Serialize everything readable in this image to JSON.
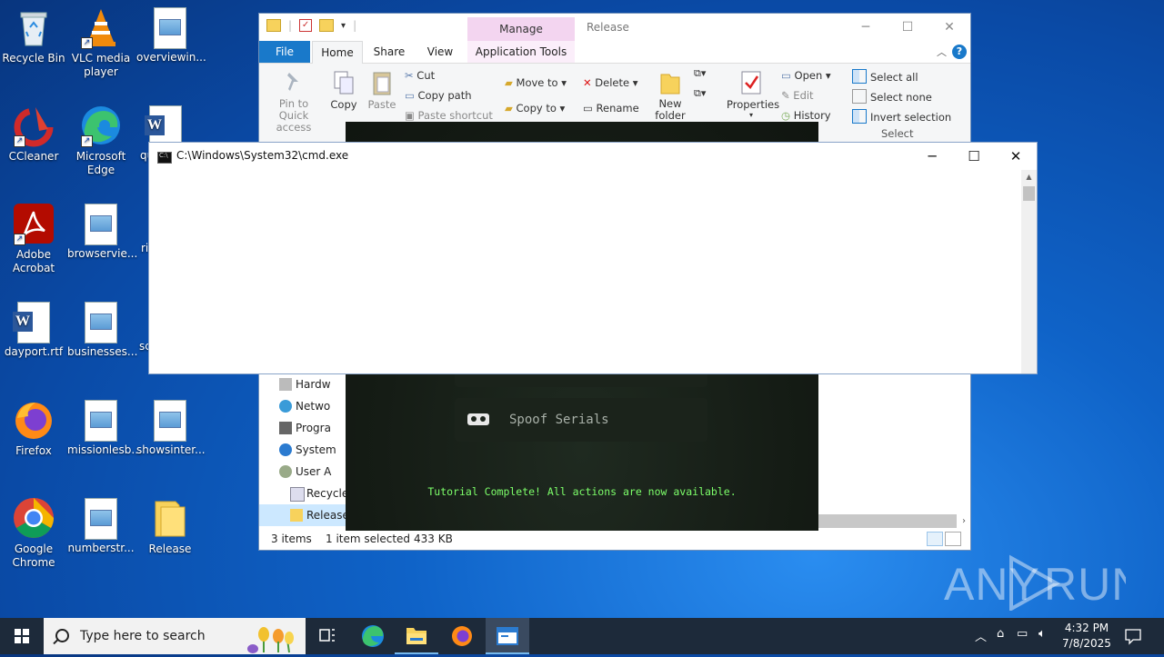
{
  "desktop": {
    "icons": [
      {
        "label": "Recycle Bin",
        "icon": "recycle-bin-icon"
      },
      {
        "label": "VLC media player",
        "icon": "vlc-icon"
      },
      {
        "label": "overviewin...",
        "icon": "image-file-icon"
      },
      {
        "label": "CCleaner",
        "icon": "ccleaner-icon"
      },
      {
        "label": "Microsoft Edge",
        "icon": "edge-icon"
      },
      {
        "label": "qu",
        "icon": "word-doc-icon"
      },
      {
        "label": "Adobe Acrobat",
        "icon": "acrobat-icon"
      },
      {
        "label": "browservie...",
        "icon": "image-file-icon"
      },
      {
        "label": "ri",
        "icon": "file-icon"
      },
      {
        "label": "dayport.rtf",
        "icon": "word-doc-icon"
      },
      {
        "label": "businesses...",
        "icon": "image-file-icon"
      },
      {
        "label": "sc",
        "icon": "file-icon"
      },
      {
        "label": "Firefox",
        "icon": "firefox-icon"
      },
      {
        "label": "missionlesb...",
        "icon": "image-file-icon"
      },
      {
        "label": "showsinter...",
        "icon": "image-file-icon"
      },
      {
        "label": "Google Chrome",
        "icon": "chrome-icon"
      },
      {
        "label": "numberstr...",
        "icon": "image-file-icon"
      },
      {
        "label": "Release",
        "icon": "folder-icon"
      }
    ]
  },
  "explorer": {
    "manage_tab": "Manage",
    "title": "Release",
    "tabs": {
      "file": "File",
      "home": "Home",
      "share": "Share",
      "view": "View",
      "app_tools": "Application Tools"
    },
    "ribbon": {
      "pin": "Pin to Quick access",
      "copy": "Copy",
      "paste": "Paste",
      "cut": "Cut",
      "copy_path": "Copy path",
      "paste_shortcut": "Paste shortcut",
      "move_to": "Move to",
      "copy_to": "Copy to",
      "delete": "Delete",
      "rename": "Rename",
      "new_folder": "New folder",
      "properties": "Properties",
      "open": "Open",
      "edit": "Edit",
      "history": "History",
      "select_all": "Select all",
      "select_none": "Select none",
      "invert_selection": "Invert selection",
      "select_group": "Select"
    },
    "nav": [
      "Hardw",
      "Netwo",
      "Progra",
      "System",
      "User A",
      "Recycle",
      "Release"
    ],
    "status": {
      "items": "3 items",
      "selected": "1 item selected",
      "size": "433 KB"
    }
  },
  "darkapp": {
    "spoof_button": "Spoof Serials",
    "message": "Tutorial Complete! All actions are now available.",
    "message_color": "#7dff6a"
  },
  "cmd": {
    "title": "C:\\Windows\\System32\\cmd.exe"
  },
  "taskbar": {
    "search_placeholder": "Type here to search",
    "time": "4:32 PM",
    "date": "7/8/2025"
  },
  "watermark": "ANY RUN"
}
